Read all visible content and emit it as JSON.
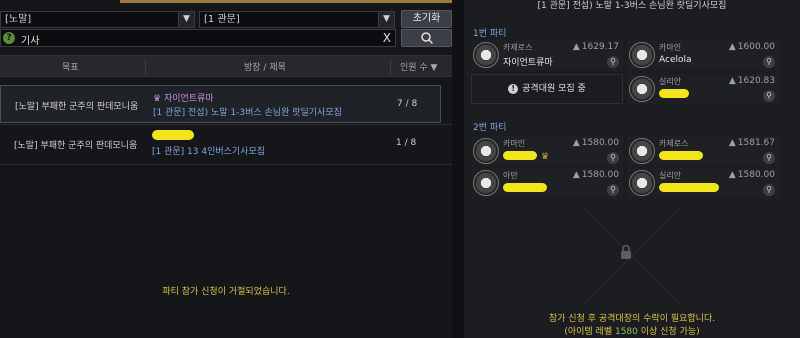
{
  "filters": {
    "region": "[노말]",
    "role": "[1 관문]",
    "reset_label": "초기화",
    "search_value": "기사",
    "help_glyph": "?",
    "clear_glyph": "X"
  },
  "table": {
    "headers": {
      "goal": "목표",
      "leader_title": "방장 / 제목",
      "members": "인원 수 ▼"
    },
    "rows": [
      {
        "goal": "[노말] 부패한 군주의 판데모니움",
        "leader": "자이언트류마",
        "title": "[1 관문] 전섭) 노말 1-3버스 손님완 랏딜기사모집",
        "count": "7 / 8",
        "selected": true
      },
      {
        "goal": "[노말] 부패한 군주의 판데모니움",
        "leader": "",
        "title": "[1 관문] 13 4인버스기사모집",
        "count": "1 / 8",
        "selected": false
      }
    ],
    "notice": "파티 참가 신청이 거절되었습니다."
  },
  "detail": {
    "title": "[1 관문] 전섭) 노말 1-3버스 손님완 랏딜기사모집",
    "party1_label": "1번 파티",
    "party2_label": "2번 파티",
    "recruit_label": "공격대원 모집 중",
    "party1": [
      {
        "class": "카제로스",
        "name": "자이언트류마",
        "ilvl": "1629.17",
        "crown": "purple"
      },
      {
        "class": "카마인",
        "name": "Acelola",
        "ilvl": "1600.00"
      },
      {
        "class": "실리안",
        "name": "",
        "ilvl": "1620.83"
      }
    ],
    "party2": [
      {
        "class": "카마인",
        "name": "",
        "ilvl": "1580.00",
        "crown": "gold"
      },
      {
        "class": "카제로스",
        "name": "",
        "ilvl": "1581.67"
      },
      {
        "class": "아만",
        "name": "",
        "ilvl": "1580.00"
      },
      {
        "class": "실리안",
        "name": "",
        "ilvl": "1580.00"
      }
    ],
    "notice1": "참가 신청 후 공격대장의 수락이 필요합니다.",
    "notice2_pre": "(아이템 레벨 ",
    "notice2_level": "1580",
    "notice2_post": " 이상 신청 가능)"
  },
  "colors": {
    "accent_gold": "#d7c54a",
    "blue_text": "#7fa6e0",
    "purple_text": "#c98fe8",
    "redaction": "#f2e51c"
  }
}
